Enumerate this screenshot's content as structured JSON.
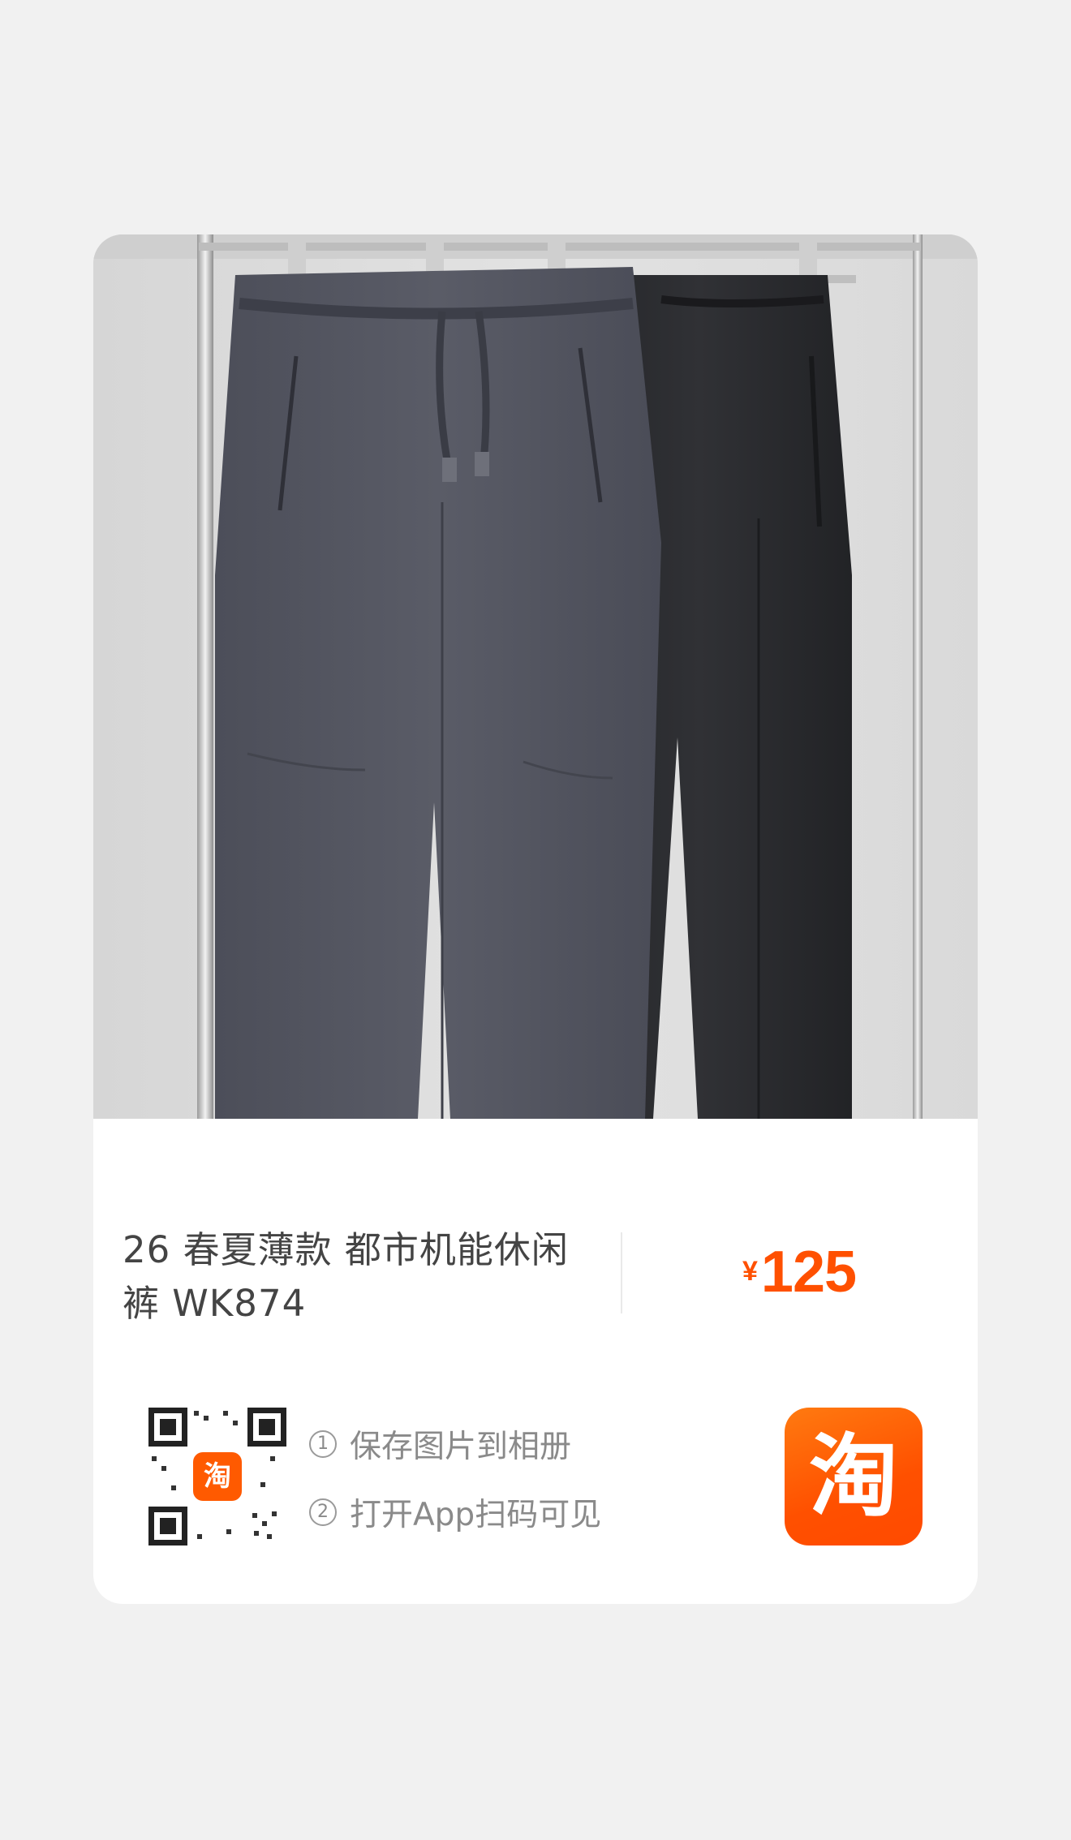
{
  "product": {
    "title_line1": "26 春夏薄款 都市机能休闲",
    "title_line2": "裤 WK874",
    "price_currency": "¥",
    "price_value": "125"
  },
  "share": {
    "qr_badge": "淘",
    "step1_num": "1",
    "step1_text": "保存图片到相册",
    "step2_num": "2",
    "step2_text": "打开App扫码可见",
    "logo_text": "淘"
  },
  "colors": {
    "accent": "#ff5000",
    "background": "#f1f1f1",
    "card": "#ffffff",
    "text": "#444444",
    "muted": "#8a8a8a"
  }
}
